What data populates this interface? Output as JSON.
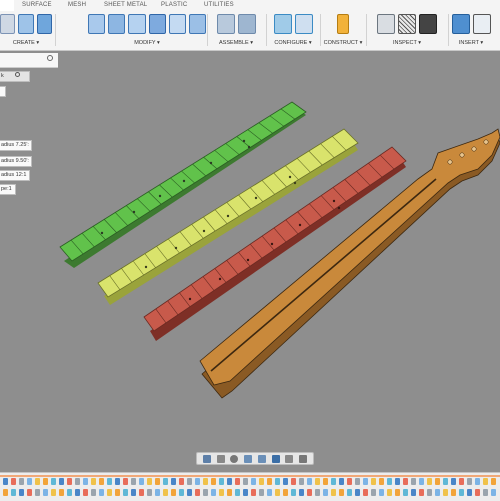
{
  "toolbar": {
    "tabs": [
      "SURFACE",
      "MESH",
      "SHEET METAL",
      "PLASTIC",
      "UTILITIES"
    ],
    "groups": [
      {
        "label": "CREATE ▾"
      },
      {
        "label": "MODIFY ▾"
      },
      {
        "label": "ASSEMBLE ▾"
      },
      {
        "label": "CONFIGURE ▾"
      },
      {
        "label": "CONSTRUCT ▾"
      },
      {
        "label": "INSPECT ▾"
      },
      {
        "label": "INSERT ▾"
      }
    ]
  },
  "browser": {
    "row_k": "k",
    "row_radius_725": "adius 7.25':",
    "row_radius_950": "adius 9.50':",
    "row_radius_12": "adius 12:1",
    "row_pe": "pe:1"
  },
  "viewport": {
    "fretboards": [
      {
        "name": "green fretboard",
        "color": "#5fc24a"
      },
      {
        "name": "yellow fretboard",
        "color": "#d7e06a"
      },
      {
        "name": "red fretboard",
        "color": "#c8584a"
      }
    ],
    "neck_color": "#c98a3c"
  },
  "navbar": {
    "icons": [
      "orbit-icon",
      "pan-icon",
      "hand-icon",
      "zoom-icon",
      "fit-icon",
      "display-icon",
      "grid-icon",
      "viewports-icon"
    ]
  },
  "colors": {
    "accent": "#2f80c8",
    "toolbar_bg": "#f4f4f4",
    "canvas_bg": "#8e8e8e"
  }
}
